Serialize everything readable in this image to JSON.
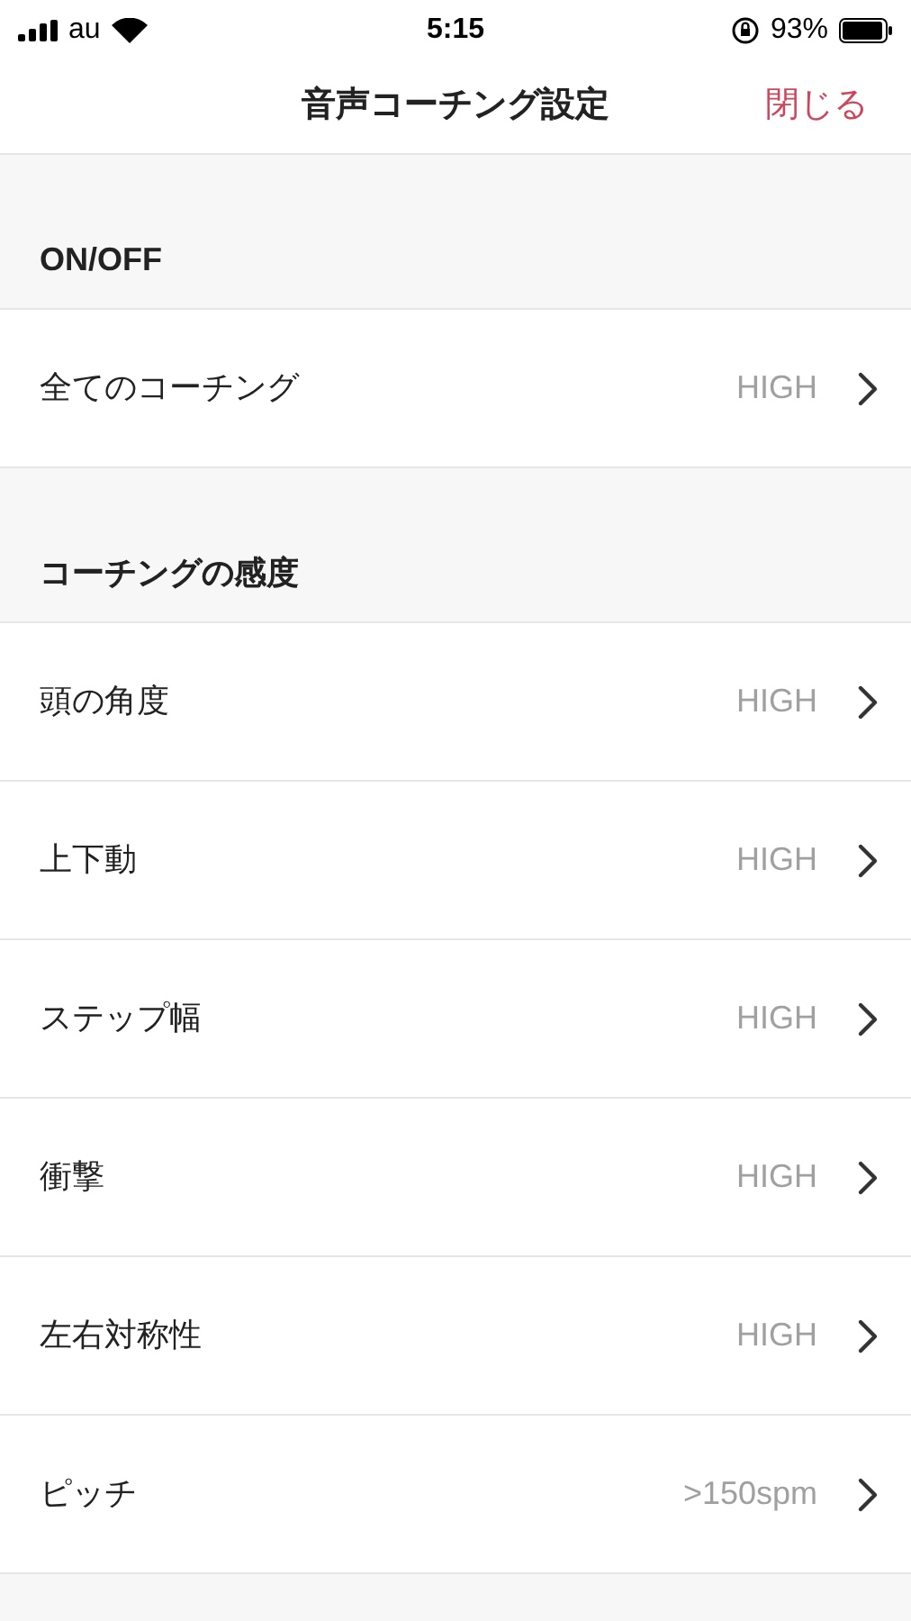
{
  "status_bar": {
    "carrier": "au",
    "time": "5:15",
    "battery": "93%"
  },
  "nav": {
    "title": "音声コーチング設定",
    "close": "閉じる"
  },
  "sections": [
    {
      "header": "ON/OFF",
      "rows": [
        {
          "label": "全てのコーチング",
          "value": "HIGH"
        }
      ]
    },
    {
      "header": "コーチングの感度",
      "rows": [
        {
          "label": "頭の角度",
          "value": "HIGH"
        },
        {
          "label": "上下動",
          "value": "HIGH"
        },
        {
          "label": "ステップ幅",
          "value": "HIGH"
        },
        {
          "label": "衝撃",
          "value": "HIGH"
        },
        {
          "label": "左右対称性",
          "value": "HIGH"
        },
        {
          "label": "ピッチ",
          "value": ">150spm"
        }
      ]
    }
  ]
}
